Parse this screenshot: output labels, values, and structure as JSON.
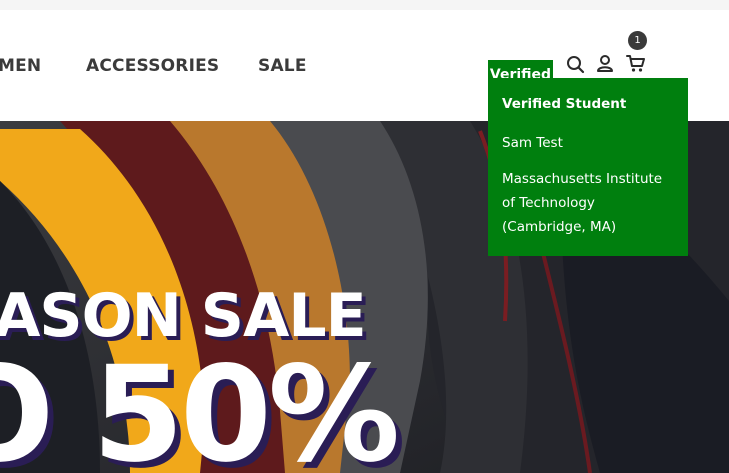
{
  "nav": {
    "items": [
      {
        "label": "MEN"
      },
      {
        "label": "ACCESSORIES"
      },
      {
        "label": "SALE"
      }
    ]
  },
  "header": {
    "verified_label": "Verified",
    "cart_count": "1",
    "icons": [
      "search-icon",
      "user-icon",
      "cart-icon"
    ]
  },
  "dropdown": {
    "title": "Verified Student",
    "name": "Sam Test",
    "school": "Massachusetts Institute of Technology (Cambridge, MA)"
  },
  "hero": {
    "line1": "ASON SALE",
    "line2": "O 50%"
  },
  "colors": {
    "verified_green": "#007f0e",
    "nav_text": "#3b3b3b",
    "hero_shadow": "#2a1d55"
  }
}
